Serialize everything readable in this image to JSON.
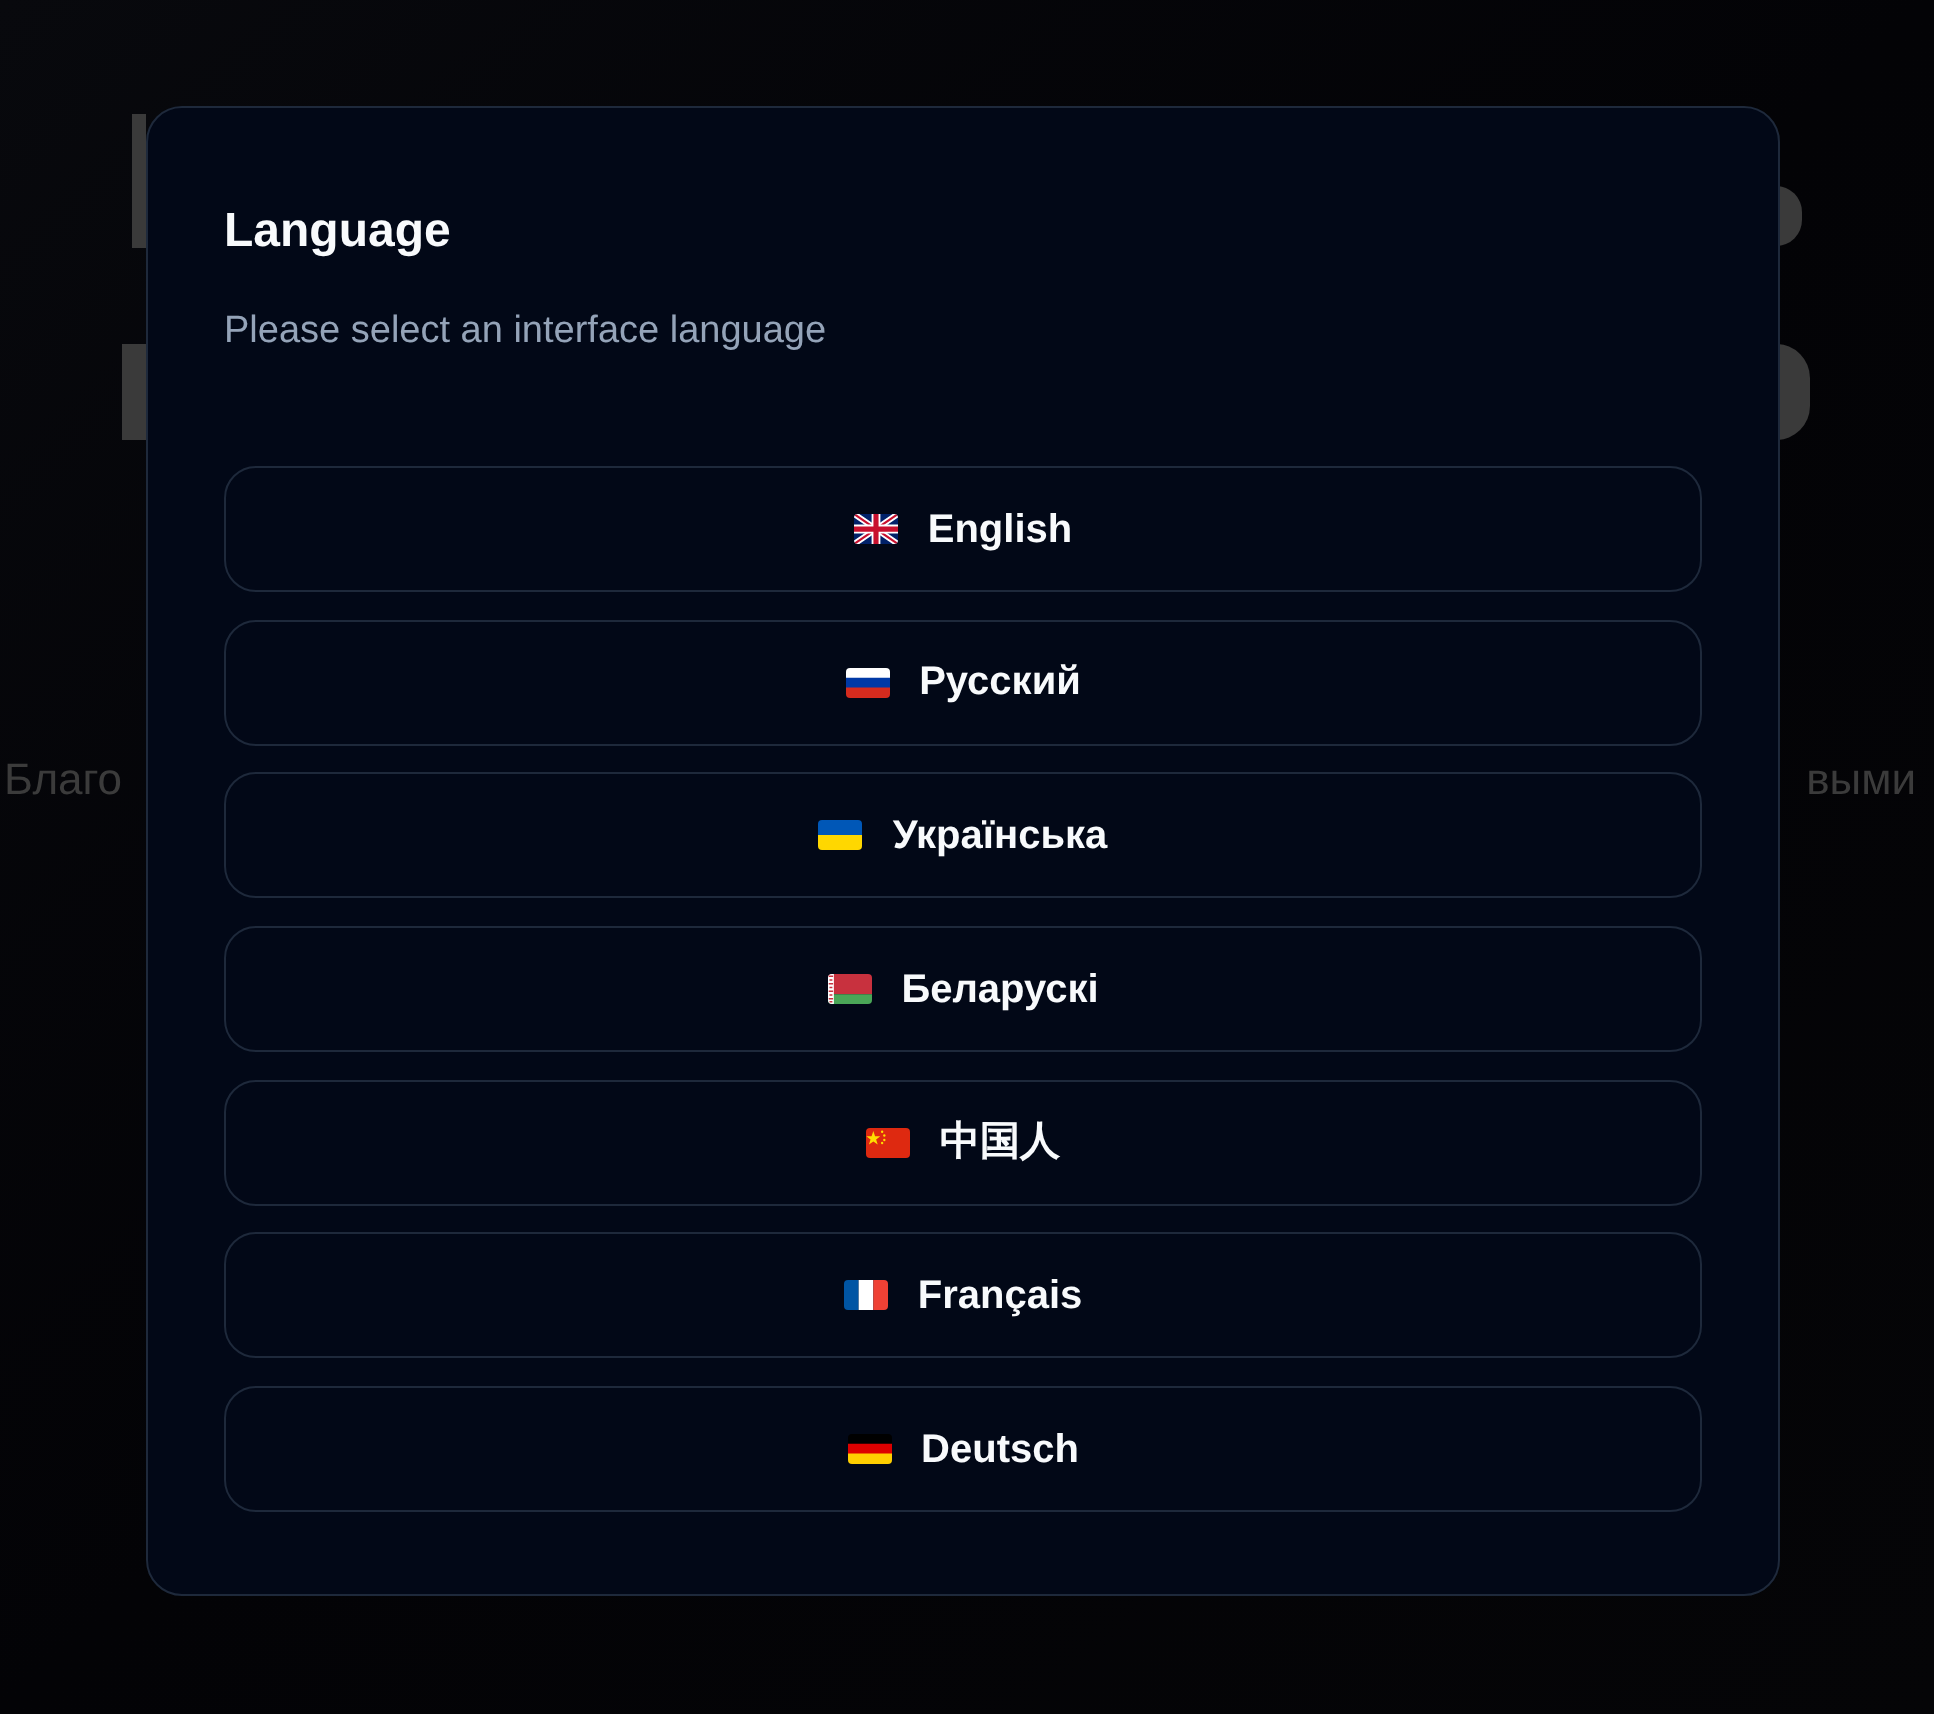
{
  "background_text": [
    "Благо",
    "выми"
  ],
  "dialog": {
    "title": "Language",
    "subtitle": "Please select an interface language",
    "options": [
      {
        "label": "English"
      },
      {
        "label": "Русский"
      },
      {
        "label": "Українська"
      },
      {
        "label": "Беларускі"
      },
      {
        "label": "中国人"
      },
      {
        "label": "Français"
      },
      {
        "label": "Deutsch"
      }
    ]
  }
}
